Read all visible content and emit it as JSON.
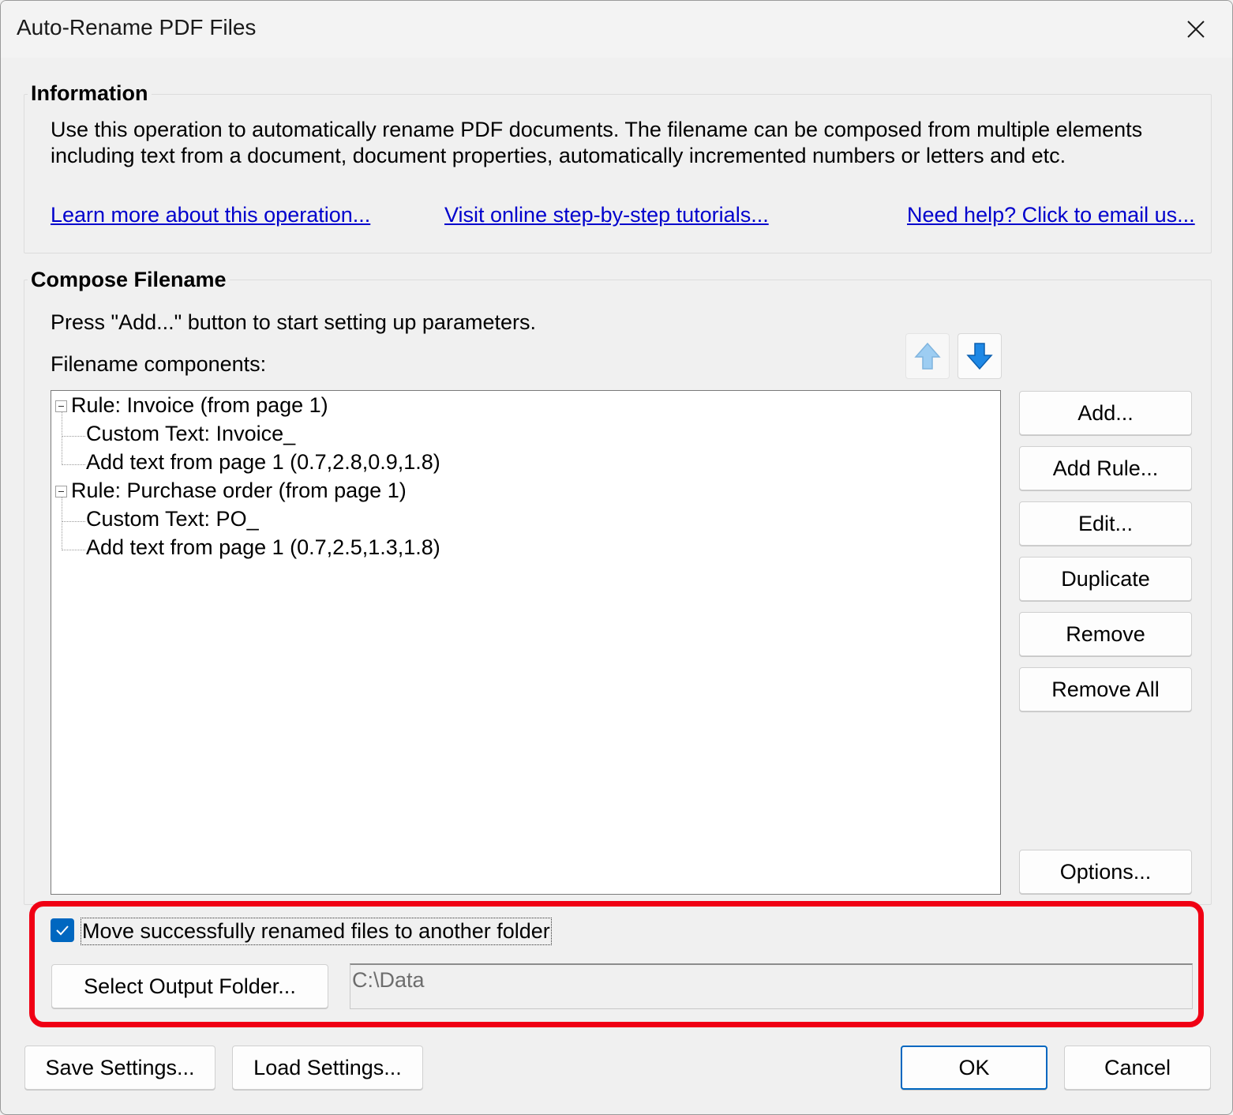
{
  "window": {
    "title": "Auto-Rename PDF Files"
  },
  "information": {
    "heading": "Information",
    "description_line1": "Use this operation to automatically rename PDF documents. The filename can be composed from multiple elements",
    "description_line2": "including text from a document, document properties, automatically incremented numbers or letters and etc.",
    "links": {
      "learn_more": "Learn more about this operation...",
      "tutorials": "Visit online step-by-step tutorials...",
      "help": "Need help? Click to email us..."
    }
  },
  "compose": {
    "heading": "Compose Filename",
    "instruction": "Press \"Add...\" button to start setting up parameters.",
    "components_label": "Filename components:",
    "tree": [
      {
        "label": "Rule: Invoice (from page 1)",
        "children": [
          "Custom Text: Invoice_",
          "Add text from page 1 (0.7,2.8,0.9,1.8)"
        ]
      },
      {
        "label": "Rule: Purchase order (from page 1)",
        "children": [
          "Custom Text: PO_",
          "Add text from page 1 (0.7,2.5,1.3,1.8)"
        ]
      }
    ],
    "buttons": {
      "add": "Add...",
      "add_rule": "Add Rule...",
      "edit": "Edit...",
      "duplicate": "Duplicate",
      "remove": "Remove",
      "remove_all": "Remove All",
      "options": "Options..."
    }
  },
  "output": {
    "move_checkbox_label": "Move successfully renamed files to another folder",
    "move_checked": true,
    "select_folder_button": "Select Output Folder...",
    "folder_path": "C:\\Data"
  },
  "footer": {
    "save_settings": "Save Settings...",
    "load_settings": "Load Settings...",
    "ok": "OK",
    "cancel": "Cancel"
  },
  "colors": {
    "accent": "#0067c0",
    "link": "#0000cc",
    "highlight": "#f00014"
  }
}
